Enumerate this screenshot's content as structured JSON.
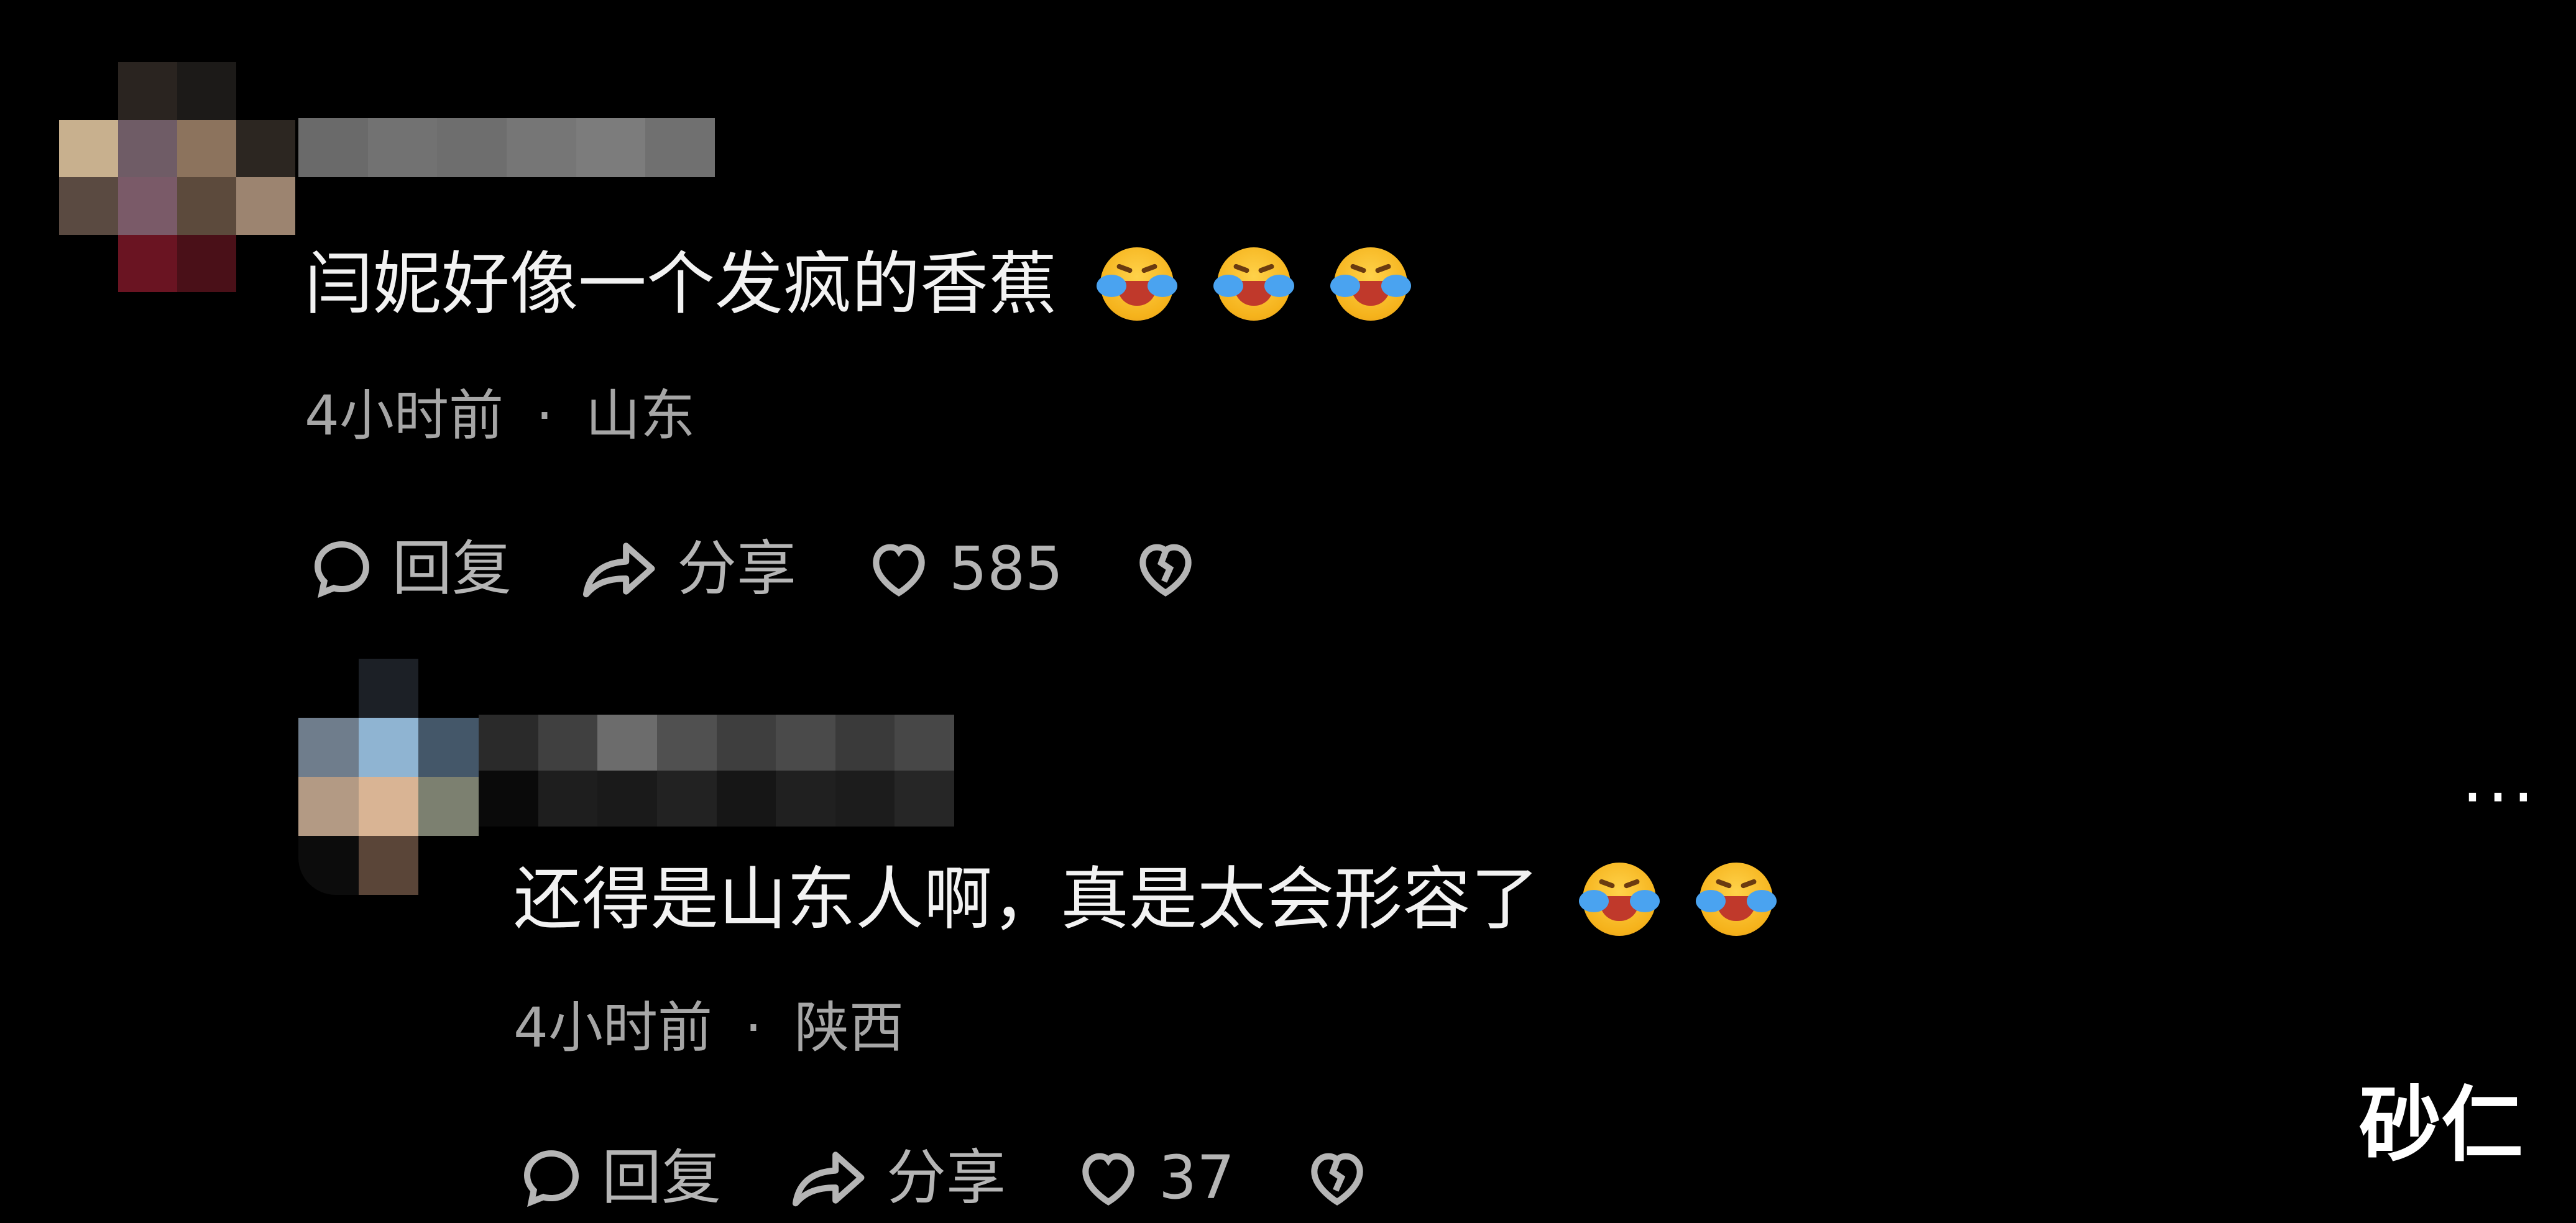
{
  "comments": [
    {
      "text": "闫妮好像一个发疯的香蕉",
      "emojis": [
        "loudly-crying-face",
        "loudly-crying-face",
        "loudly-crying-face"
      ],
      "time": "4小时前",
      "location": "山东",
      "reply_label": "回复",
      "share_label": "分享",
      "like_count": "585"
    },
    {
      "text": "还得是山东人啊，真是太会形容了",
      "emojis": [
        "loudly-crying-face",
        "loudly-crying-face"
      ],
      "time": "4小时前",
      "location": "陕西",
      "reply_label": "回复",
      "share_label": "分享",
      "like_count": "37"
    }
  ],
  "separator": "·",
  "more_menu": "···",
  "watermark": "砂仁",
  "colors": {
    "background": "#000000",
    "text": "#f2f2f2",
    "meta": "#a6a6a6"
  }
}
